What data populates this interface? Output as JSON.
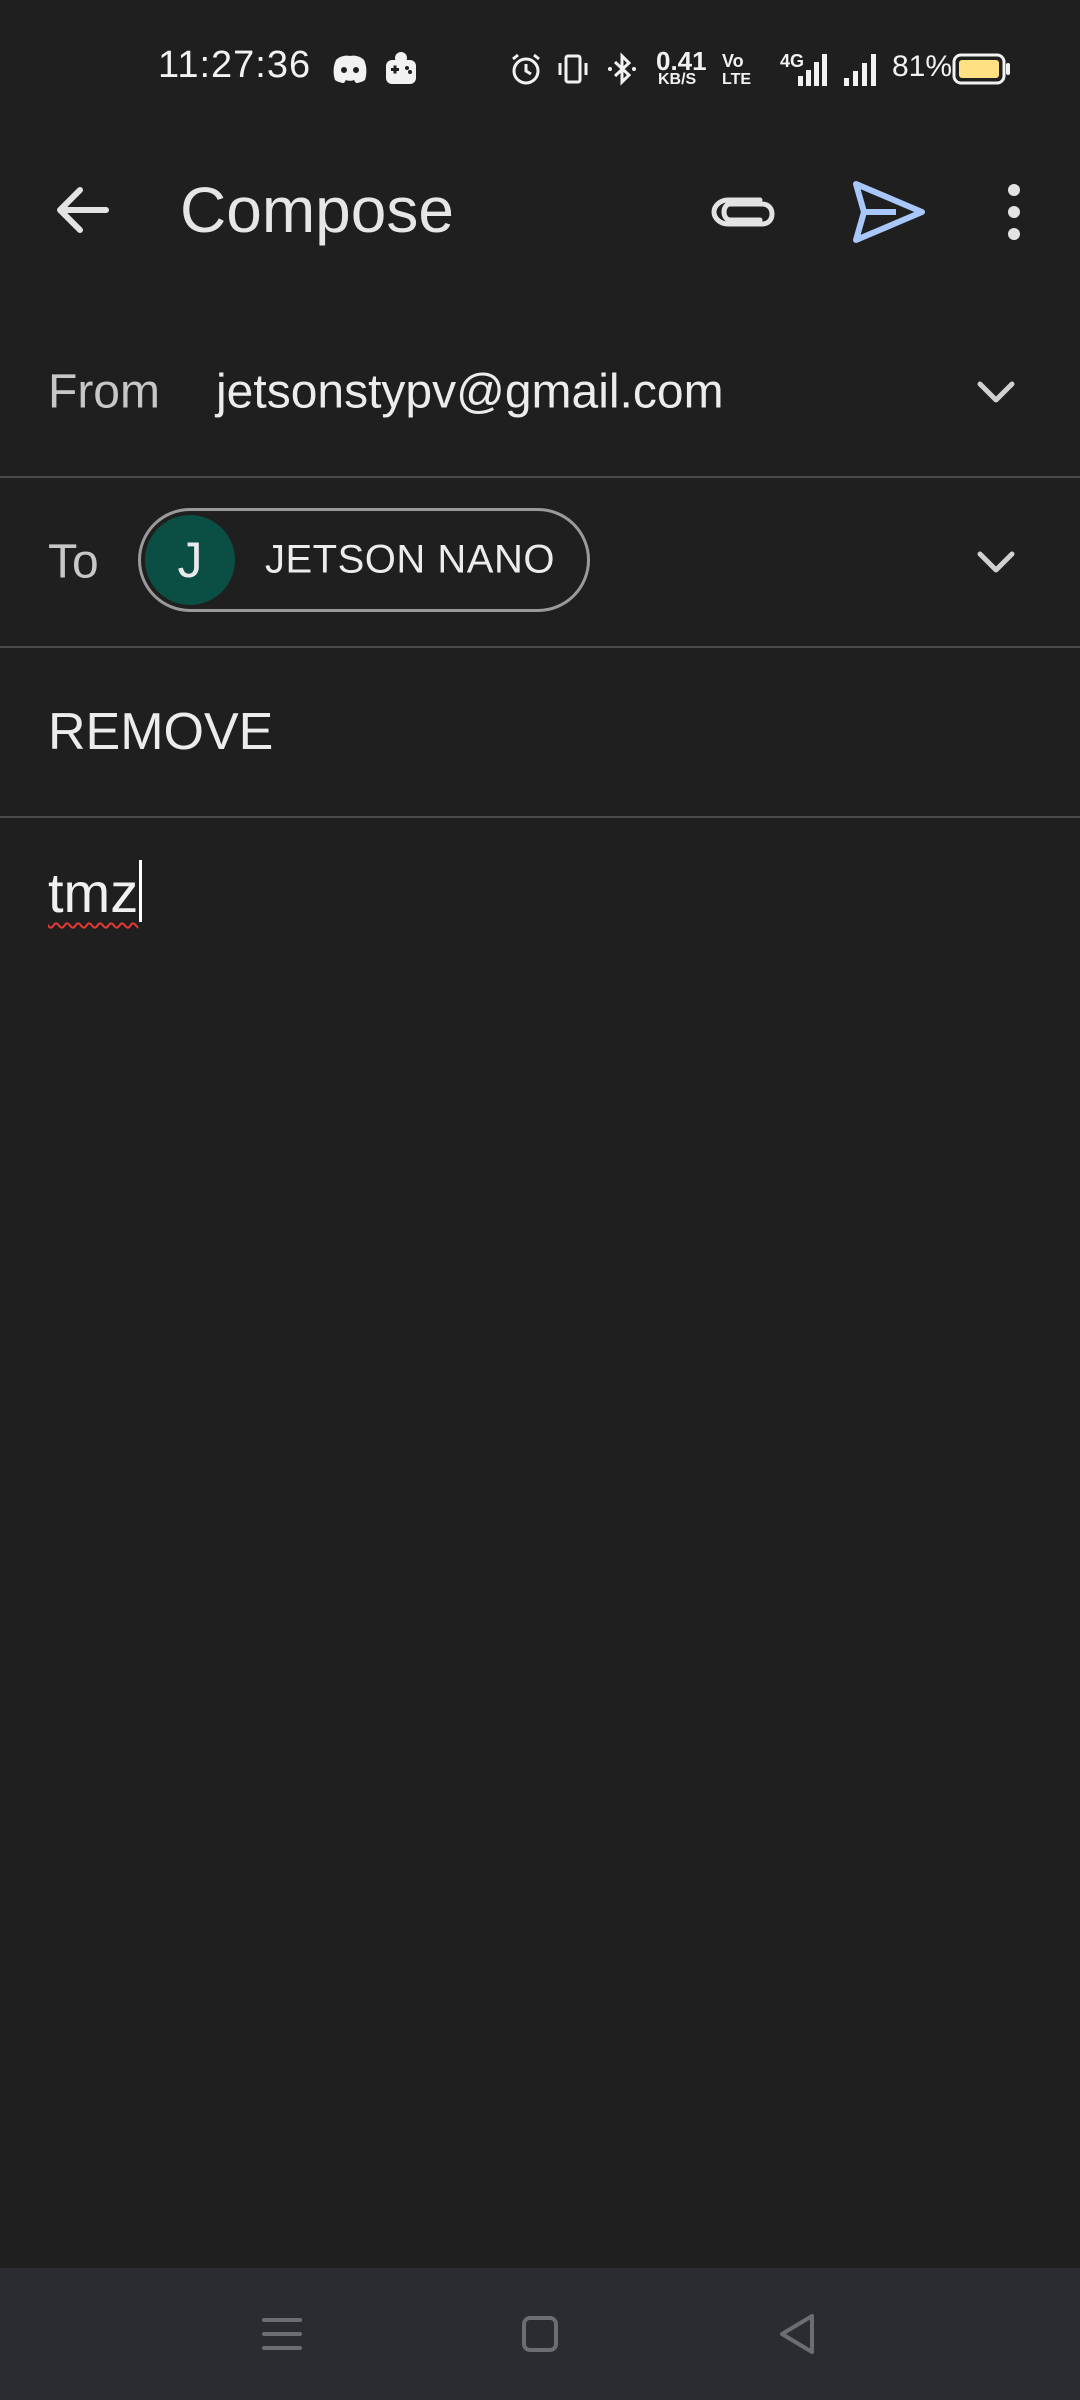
{
  "status_bar": {
    "time": "11:27:36",
    "net_speed_value": "0.41",
    "net_speed_unit": "KB/S",
    "volte_top": "Vo",
    "volte_bottom": "LTE",
    "network_type": "4G",
    "battery_percent": "81%",
    "icons": [
      "discord-icon",
      "game-controller-icon",
      "alarm-icon",
      "vibrate-icon",
      "bluetooth-icon",
      "volte-icon",
      "signal-4g-icon",
      "signal-icon",
      "battery-icon"
    ],
    "battery_color": "#ffe082"
  },
  "app_bar": {
    "title": "Compose",
    "send_color": "#a8c7fa"
  },
  "from_field": {
    "label": "From",
    "value": "jetsonstypv@gmail.com"
  },
  "to_field": {
    "label": "To",
    "chip_initial": "J",
    "chip_name": "JETSON NANO",
    "avatar_color": "#0b4f44"
  },
  "subject_field": {
    "value": "REMOVE"
  },
  "body": {
    "text": "tmz"
  },
  "nav_bar": {
    "icons": [
      "menu-icon",
      "home-icon",
      "back-icon"
    ]
  }
}
